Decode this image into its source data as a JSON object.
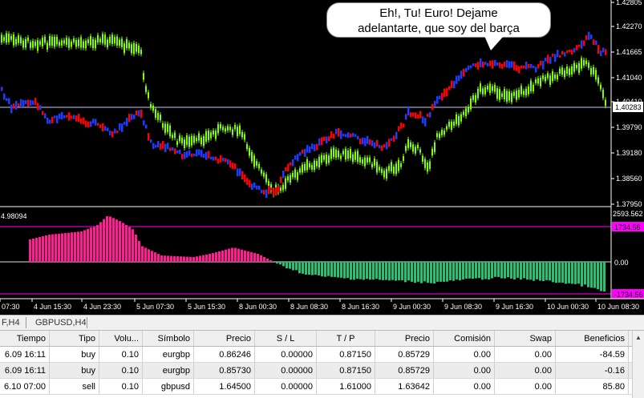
{
  "annotation": {
    "line1": "Eh!, Tu! Euro! Dejame",
    "line2": "adelantarte, que soy del barça"
  },
  "price_axis": [
    "1.42805",
    "1.42270",
    "1.41665",
    "1.41040",
    "1.40410",
    "1.39790",
    "1.39180",
    "1.38560",
    "1.37950"
  ],
  "current_price": "1.40283",
  "indicator": {
    "value_label": "4.98094",
    "axis_top": "2593.562",
    "upper_level": "1734.56",
    "zero": "0.00",
    "lower_level": "-1734.56"
  },
  "time_axis": [
    "07:30",
    "4 Jun 15:30",
    "4 Jun 23:30",
    "5 Jun 07:30",
    "5 Jun 15:30",
    "8 Jun 00:30",
    "8 Jun 08:30",
    "8 Jun 16:30",
    "9 Jun 00:30",
    "9 Jun 08:30",
    "9 Jun 16:30",
    "10 Jun 00:30",
    "10 Jun 08:30"
  ],
  "tabs": [
    "F,H4",
    "GBPUSD,H4"
  ],
  "table": {
    "headers": [
      "Tiempo",
      "Tipo",
      "Volu...",
      "Símbolo",
      "Precio",
      "S / L",
      "T / P",
      "Precio",
      "Comisión",
      "Swap",
      "Beneficios"
    ],
    "rows": [
      [
        "6.09 16:11",
        "buy",
        "0.10",
        "eurgbp",
        "0.86246",
        "0.00000",
        "0.87150",
        "0.85729",
        "0.00",
        "0.00",
        "-84.59"
      ],
      [
        "6.09 16:11",
        "buy",
        "0.10",
        "eurgbp",
        "0.85730",
        "0.00000",
        "0.87150",
        "0.85729",
        "0.00",
        "0.00",
        "-0.16"
      ],
      [
        "6.10 07:00",
        "sell",
        "0.10",
        "gbpusd",
        "1.64500",
        "0.00000",
        "1.61000",
        "1.63642",
        "0.00",
        "0.00",
        "85.80"
      ]
    ]
  },
  "colors": {
    "green": "#7fff00",
    "red": "#ff0000",
    "blue": "#1e3cff",
    "pink": "#ff1f8f",
    "teal": "#2fbf73",
    "level_line": "#ff00ff",
    "grid_line": "#c8c8ff"
  }
}
